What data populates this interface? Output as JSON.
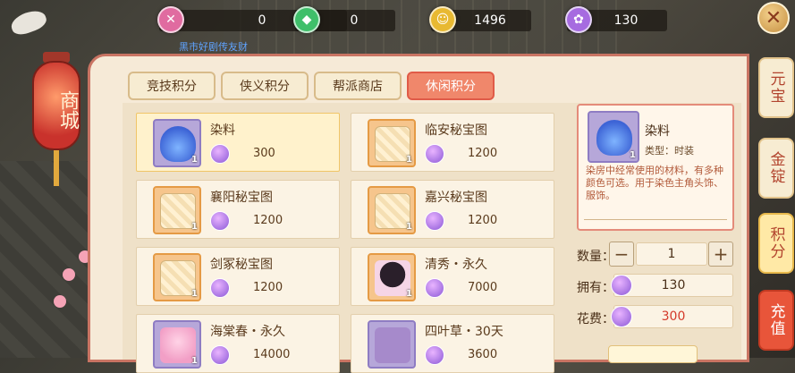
{
  "currencies": [
    {
      "icon": "pink-gem-icon",
      "value": "0"
    },
    {
      "icon": "green-gem-icon",
      "value": "0"
    },
    {
      "icon": "gold-coin-icon",
      "value": "1496"
    },
    {
      "icon": "purple-star-icon",
      "value": "130"
    }
  ],
  "sub_label": "黑市好剧传友财",
  "lantern": {
    "text": "商城"
  },
  "tabs": [
    {
      "label": "竞技积分",
      "active": false
    },
    {
      "label": "侠义积分",
      "active": false
    },
    {
      "label": "帮派商店",
      "active": false
    },
    {
      "label": "休闲积分",
      "active": true
    }
  ],
  "items": [
    {
      "name": "染料",
      "price": "300",
      "qty": "1"
    },
    {
      "name": "临安秘宝图",
      "price": "1200",
      "qty": "1"
    },
    {
      "name": "襄阳秘宝图",
      "price": "1200",
      "qty": "1"
    },
    {
      "name": "嘉兴秘宝图",
      "price": "1200",
      "qty": "1"
    },
    {
      "name": "剑冢秘宝图",
      "price": "1200",
      "qty": "1"
    },
    {
      "name": "清秀・永久",
      "price": "7000",
      "qty": "1"
    },
    {
      "name": "海棠春・永久",
      "price": "14000",
      "qty": "1"
    },
    {
      "name": "四叶草・30天",
      "price": "3600",
      "qty": ""
    }
  ],
  "detail": {
    "name": "染料",
    "qty": "1",
    "type": "类型：时装",
    "description": "染房中经常使用的材料，有多种颜色可选。用于染色主角头饰、服饰。"
  },
  "purchase": {
    "quantity_label": "数量：",
    "quantity": "1",
    "minus": "−",
    "plus": "+",
    "owned_label": "拥有：",
    "owned": "130",
    "cost_label": "花费：",
    "cost": "300"
  },
  "side_tabs": [
    {
      "label": "元宝"
    },
    {
      "label": "金锭"
    },
    {
      "label": "积分"
    },
    {
      "label": "充值"
    }
  ],
  "colors": {
    "accent": "#f0876b",
    "panel_bg": "#f6ead7",
    "cost_red": "#d43a2a",
    "hint_blue": "#5fa3ff"
  }
}
